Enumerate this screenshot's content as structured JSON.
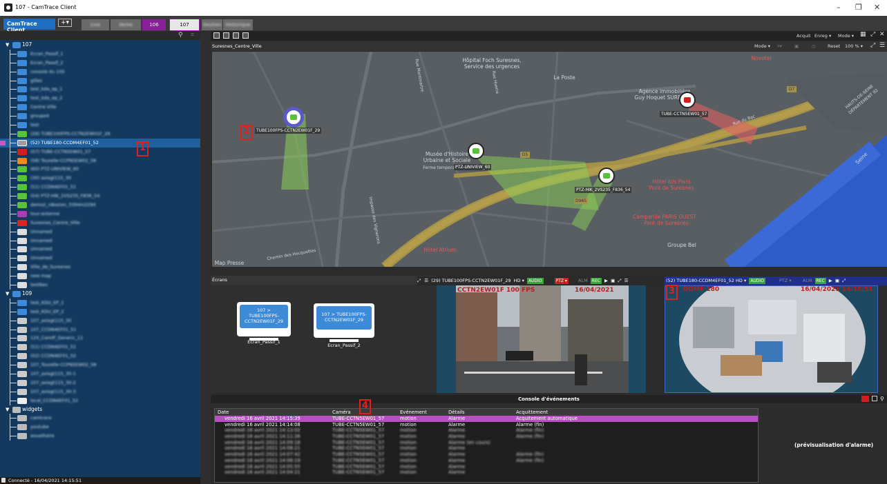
{
  "window": {
    "title": "107 - CamTrace Client",
    "controls": [
      "–",
      "❐",
      "✕"
    ]
  },
  "tabbar": {
    "app_label": "CamTrace Client",
    "add_label": "+▾",
    "tabs": [
      {
        "label": "Live",
        "blurred": true,
        "color": "#6a6a6a"
      },
      {
        "label": "demo",
        "blurred": true,
        "color": "#6a6a6a"
      },
      {
        "label": "106",
        "blurred": false,
        "color": "#8a1f9a"
      },
      {
        "label": "107",
        "blurred": false,
        "color": "#e7e7e7",
        "active": true
      },
      {
        "label": "Gestion",
        "blurred": true,
        "color": "#6a6a6a"
      },
      {
        "label": "Historique",
        "blurred": true,
        "color": "#6a6a6a"
      }
    ]
  },
  "tree": {
    "root_107": "107",
    "items_107": [
      {
        "label": "Ecran_Passif_1",
        "icon": "monitor-icon",
        "color": "#3d8ad6"
      },
      {
        "label": "Ecran_Passif_2",
        "icon": "monitor-icon",
        "color": "#3d8ad6"
      },
      {
        "label": "console du 105",
        "icon": "monitor-icon",
        "color": "#3d8ad6"
      },
      {
        "label": "gilles",
        "icon": "monitor-icon",
        "color": "#3d8ad6"
      },
      {
        "label": "test_kda_ep_1",
        "icon": "monitor-icon",
        "color": "#3d8ad6"
      },
      {
        "label": "test_kda_ep_2",
        "icon": "monitor-icon",
        "color": "#3d8ad6"
      },
      {
        "label": "Centre Ville",
        "icon": "grid-icon",
        "color": "#3d8ad6"
      },
      {
        "label": "groupe4",
        "icon": "grid-icon",
        "color": "#3d8ad6"
      },
      {
        "label": "test",
        "icon": "grid-icon",
        "color": "#3d8ad6"
      },
      {
        "label": "(29) TUBE100FPS-CCTN2EW01F_29",
        "icon": "camera-icon",
        "color": "#5ac23a"
      },
      {
        "label": "(52) TUBE180-CCDM4EF01_52",
        "icon": "camera-icon",
        "color": "#9e9e9e",
        "selected": true
      },
      {
        "label": "(57) TUBE-CCTN5EW01_57",
        "icon": "camera-icon",
        "color": "#d21e1e"
      },
      {
        "label": "(58) Tourelle-CCPN5EW02_58",
        "icon": "camera-icon",
        "color": "#f08c1e"
      },
      {
        "label": "(60) PTZ-UNIVIEW_60",
        "icon": "camera-icon",
        "color": "#5ac23a"
      },
      {
        "label": "(30) axisgt115_30",
        "icon": "camera-icon",
        "color": "#5ac23a"
      },
      {
        "label": "(51) CCDN4EF01_51",
        "icon": "camera-icon",
        "color": "#5ac23a"
      },
      {
        "label": "(54) PTZ-HIK_2VS235_F836_54",
        "icon": "camera-icon",
        "color": "#5ac23a"
      },
      {
        "label": "demo2_nBoxion_3394m2294",
        "icon": "camera-icon",
        "color": "#5ac23a"
      },
      {
        "label": "tour-antenne",
        "icon": "list-icon",
        "color": "#b03ab0"
      },
      {
        "label": "Suresnes_Centre_Ville",
        "icon": "map-icon",
        "color": "#d22"
      },
      {
        "label": "Unnamed",
        "icon": "map-icon",
        "color": "#ddd"
      },
      {
        "label": "Unnamed",
        "icon": "map-icon",
        "color": "#ddd"
      },
      {
        "label": "Unnamed",
        "icon": "map-icon",
        "color": "#ddd"
      },
      {
        "label": "Unnamed",
        "icon": "map-icon",
        "color": "#ddd"
      },
      {
        "label": "Ville_de_Suresnes",
        "icon": "map-icon",
        "color": "#ddd"
      },
      {
        "label": "new map",
        "icon": "map-icon",
        "color": "#ddd"
      },
      {
        "label": "testNav",
        "icon": "map-icon",
        "color": "#ddd"
      }
    ],
    "root_109": "109",
    "items_109": [
      {
        "label": "test_KDU_EP_1",
        "icon": "monitor-icon",
        "color": "#3d8ad6"
      },
      {
        "label": "test_KDU_EP_2",
        "icon": "monitor-icon",
        "color": "#3d8ad6"
      },
      {
        "label": "107_axisgt115_30",
        "icon": "camera-icon",
        "color": "#ccc"
      },
      {
        "label": "107_CCDN4EF01_51",
        "icon": "camera-icon",
        "color": "#ccc"
      },
      {
        "label": "124_CamIP_Generic_11",
        "icon": "camera-icon",
        "color": "#ccc"
      },
      {
        "label": "(51) CCDN4EF01_51",
        "icon": "camera-icon",
        "color": "#ccc"
      },
      {
        "label": "(52) CCDN4EF01_52",
        "icon": "camera-icon",
        "color": "#ccc"
      },
      {
        "label": "107_Tourelle-CCPN5EW02_58",
        "icon": "camera-icon",
        "color": "#ccc"
      },
      {
        "label": "107_axisgt115_30-1",
        "icon": "camera-icon",
        "color": "#ccc"
      },
      {
        "label": "107_axisgt115_30-2",
        "icon": "camera-icon",
        "color": "#ccc"
      },
      {
        "label": "107_axisgt115_30-3",
        "icon": "camera-icon",
        "color": "#ccc"
      },
      {
        "label": "local_CCDN4EF01_52",
        "icon": "map-icon",
        "color": "#eee"
      }
    ],
    "root_widgets": "widgets",
    "items_widgets": [
      {
        "label": "camtrace",
        "icon": "widget-icon",
        "color": "#bbb"
      },
      {
        "label": "youtube",
        "icon": "widget-icon",
        "color": "#bbb"
      },
      {
        "label": "aoualitaire",
        "icon": "widget-icon",
        "color": "#bbb"
      }
    ]
  },
  "status": {
    "text": "Connecté - 16/04/2021 14:15:51"
  },
  "toolbar": {
    "acquit": "Acquit",
    "enreg": "Enreg ▾",
    "mode": "Mode ▾"
  },
  "map_panel": {
    "name": "Suresnes_Centre_Ville",
    "mode": "Mode ▾",
    "reset": "Reset",
    "zoom": "100 % ▾",
    "labels": {
      "hopital": "Hôpital Foch Suresnes,\nService des urgences",
      "laposte": "La Poste",
      "novotel": "Novotel",
      "agence": "Agence immobilière\nGuy Hoquet SURESNES",
      "musee": "Musée d'Histoire\nUrbaine et Sociale",
      "ferme": "Ferme temporairement",
      "hotelibis": "Hôtel ibis Paris\nPont de Suresnes",
      "campanile": "Campanile PARIS OUEST\n- Pont de Suresnes",
      "groupebel": "Groupe Bel",
      "atrium": "Hôtel Atrium",
      "mappresse": "Map Presse",
      "hauts": "HAUTS-DE-SEINE\nDÉPARTEMENT 92",
      "seine": "Seine",
      "bac": "Rue du Bac",
      "vignerons": "Impasse des Vignerons",
      "montmartre": "Rue Montmartre",
      "chemin": "Chemin des Hocquettes",
      "rue_huerre": "Rue Huerre",
      "d7": "D7",
      "d5": "D5",
      "d985": "D985"
    },
    "cameras": [
      {
        "name": "TUBE100FPS-CCTN2EW01F_29",
        "color": "#5ac23a"
      },
      {
        "name": "TUBE-CCTN5EW01_57",
        "color": "#d21e1e"
      },
      {
        "name": "PTZ-UNIVIEW_60",
        "color": "#5ac23a"
      },
      {
        "name": "PTZ-HIK_2VS235_F836_54",
        "color": "#5ac23a"
      }
    ]
  },
  "screens_panel": {
    "title": "Écrans",
    "screens": [
      {
        "inner": "107 >\nTUBE100FPS-\nCCTN2EW01F_29",
        "label": "Ecran_Passif_1"
      },
      {
        "inner": "107 > TUBE100FPS-\nCCTN2EW01F_29",
        "label": "Ecran_Passif_2"
      }
    ]
  },
  "video1": {
    "title": "(29) TUBE100FPS-CCTN2EW01F_29",
    "hd": "HD ▾",
    "audio": "AUDIO",
    "ptz": "PTZ ▾",
    "alm": "ALM",
    "rec": "REC",
    "overlay_left": "CCTN2EW01F 100 FPS",
    "overlay_right": "16/04/2021"
  },
  "video2": {
    "title": "(52) TUBE180-CCDM4EF01_52",
    "hd": "HD ▾",
    "audio": "AUDIO",
    "ptz": "PTZ ▾",
    "alm": "ALM",
    "rec": "REC",
    "overlay_left": "DOME 180",
    "overlay_right": "16/04/2021 14:15:51"
  },
  "console": {
    "title": "Console d'événements",
    "columns": [
      "Date",
      "Caméra",
      "Evénement",
      "Détails",
      "Acquittement"
    ],
    "rows": [
      {
        "date": "vendredi 16 avril 2021 14:15:39",
        "camera": "TUBE-CCTN5EW01_57",
        "event": "motion",
        "details": "Alarme",
        "ack": "Acquitement automatique",
        "hi": true
      },
      {
        "date": "vendredi 16 avril 2021 14:14:08",
        "camera": "TUBE-CCTN5EW01_57",
        "event": "motion",
        "details": "Alarme",
        "ack": "Alarme (fin)"
      },
      {
        "date": "vendredi 16 avril 2021 14:13:02",
        "camera": "TUBE-CCTN5EW01_57",
        "event": "motion",
        "details": "Alarme",
        "ack": "Alarme (fin)",
        "blur": true
      },
      {
        "date": "vendredi 16 avril 2021 14:11:26",
        "camera": "TUBE-CCTN5EW01_57",
        "event": "motion",
        "details": "Alarme",
        "ack": "Alarme (fin)",
        "blur": true
      },
      {
        "date": "vendredi 16 avril 2021 14:09:18",
        "camera": "TUBE-CCTN5EW01_57",
        "event": "motion",
        "details": "Alarme (en cours)",
        "ack": "",
        "blur": true
      },
      {
        "date": "vendredi 16 avril 2021 14:08:21",
        "camera": "TUBE-CCTN5EW01_57",
        "event": "motion",
        "details": "Alarme",
        "ack": "",
        "blur": true
      },
      {
        "date": "vendredi 16 avril 2021 14:07:42",
        "camera": "TUBE-CCTN5EW01_57",
        "event": "motion",
        "details": "Alarme",
        "ack": "Alarme (fin)",
        "blur": true
      },
      {
        "date": "vendredi 16 avril 2021 14:06:19",
        "camera": "TUBE-CCTN5EW01_57",
        "event": "motion",
        "details": "Alarme",
        "ack": "Alarme (fin)",
        "blur": true
      },
      {
        "date": "vendredi 16 avril 2021 14:05:55",
        "camera": "TUBE-CCTN5EW01_57",
        "event": "motion",
        "details": "Alarme",
        "ack": "",
        "blur": true
      },
      {
        "date": "vendredi 16 avril 2021 14:04:21",
        "camera": "TUBE-CCTN5EW01_57",
        "event": "motion",
        "details": "Alarme",
        "ack": "",
        "blur": true
      }
    ],
    "preview": "(prévisualisation d'alarme)"
  },
  "annotations": [
    "1",
    "2",
    "3",
    "4"
  ]
}
